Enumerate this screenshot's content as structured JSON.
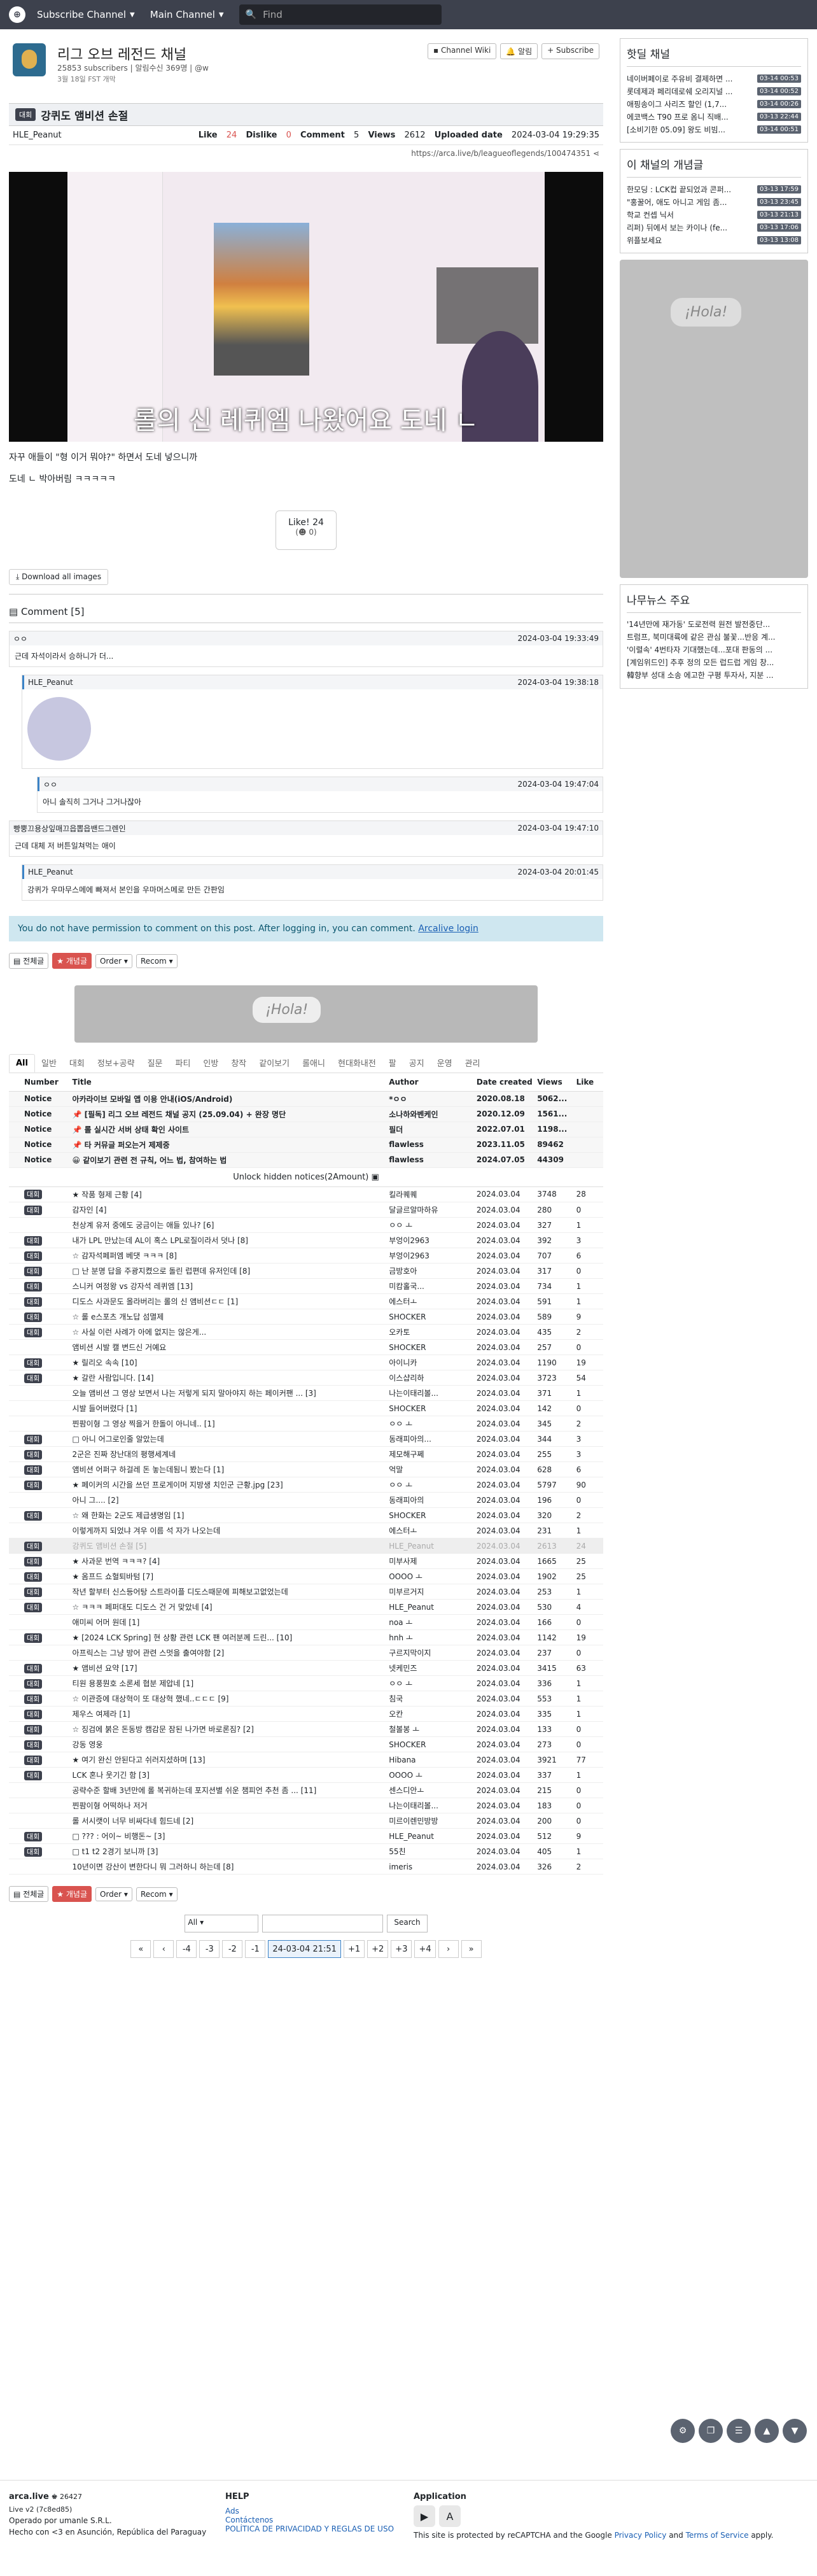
{
  "nav": {
    "channel_menu": "Subscribe Channel",
    "main_menu": "Main Channel",
    "search_placeholder": "Find"
  },
  "channel": {
    "name": "리그 오브 레전드 채널",
    "meta": "25853 subscribers | 알림수신 369명 | @w",
    "created": "3월 18일 FST 개막",
    "btn_wiki": "Channel Wiki",
    "btn_alarm": "알림",
    "btn_sub": "Subscribe"
  },
  "post": {
    "badge": "대회",
    "title": "강퀴도 앰비션 손절",
    "author": "HLE_Peanut",
    "like_label": "Like",
    "like": "24",
    "dislike_label": "Dislike",
    "dislike": "0",
    "comment_label": "Comment",
    "comments": "5",
    "views_label": "Views",
    "views": "2612",
    "uploaded_label": "Uploaded date",
    "uploaded": "2024-03-04 19:29:35",
    "url": "https://arca.live/b/leagueoflegends/100474351",
    "subtitle": "롤의 신 레퀴엠 나왔어요 도네 ㄴ",
    "line1": "자꾸 애들이 \"형 이거 뭐야?\" 하면서 도네 넣으니까",
    "line2": "도네 ㄴ 박아버림 ㅋㅋㅋㅋㅋ",
    "like_btn": "Like!",
    "like_btn_count": "24",
    "like_btn_sub": "0",
    "download": "Download all images"
  },
  "comments": {
    "header": "Comment [5]",
    "items": [
      {
        "author": "ㅇㅇ",
        "time": "2024-03-04 19:33:49",
        "text": "근데 자석이라서 승하니가 더..."
      },
      {
        "author": "HLE_Peanut",
        "time": "2024-03-04 19:38:18",
        "text": ""
      },
      {
        "author": "ㅇㅇ",
        "time": "2024-03-04 19:47:04",
        "text": "아니 솔직히 그거나 그거나잖아"
      },
      {
        "author": "빵뿡끄용상잎매끄읍뽑읍밴드그렌인",
        "time": "2024-03-04 19:47:10",
        "text": "근데 대체 저 버튼일쳐먹는 애이"
      },
      {
        "author": "HLE_Peanut",
        "time": "2024-03-04 20:01:45",
        "text": "강퀴가 우마무스메에 빠져서 본인을 우마머스메로 만든 간판임"
      }
    ],
    "notice": "You do not have permission to comment on this post. After logging in, you can comment.",
    "login": "Arcalive login"
  },
  "toolbar": {
    "all": "전체글",
    "best": "개념글",
    "order": "Order",
    "recom": "Recom"
  },
  "ad_text": "¡Hola!",
  "tabs": [
    "All",
    "일반",
    "대회",
    "정보+공략",
    "질문",
    "파티",
    "인방",
    "창작",
    "같이보기",
    "롤애니",
    "현대화내전",
    "팔",
    "공지",
    "운영",
    "관리"
  ],
  "table": {
    "headers": [
      "Number",
      "Title",
      "Author",
      "Date created",
      "Views",
      "Like"
    ],
    "notices": [
      {
        "n": "Notice",
        "t": "아카라이브 모바일 앱 이용 안내(iOS/Android)",
        "a": "*ㅇㅇ",
        "d": "2020.08.18",
        "v": "5062...",
        "l": ""
      },
      {
        "n": "Notice",
        "t": "📌 [필독] 리그 오브 레전드 채널 공지 (25.09.04) + 완장 명단",
        "a": "소나하와벤케인",
        "d": "2020.12.09",
        "v": "1561...",
        "l": ""
      },
      {
        "n": "Notice",
        "t": "📌 롤 실시간 서버 상태 확인 사이트",
        "a": "필더",
        "d": "2022.07.01",
        "v": "1198...",
        "l": ""
      },
      {
        "n": "Notice",
        "t": "📌 타 커뮤글 퍼오는거 제제중",
        "a": "flawless",
        "d": "2023.11.05",
        "v": "89462",
        "l": ""
      },
      {
        "n": "Notice",
        "t": "😀 같이보기 관련 전 규칙, 어느 법, 참여하는 법",
        "a": "flawless",
        "d": "2024.07.05",
        "v": "44309",
        "l": ""
      }
    ],
    "unlock": "Unlock hidden notices(2Amount)",
    "rows": [
      {
        "c": "대회",
        "t": "★ 작품 형제 근황 [4]",
        "a": "킬라퀘퀘",
        "d": "2024.03.04",
        "v": "3748",
        "l": "28"
      },
      {
        "c": "대회",
        "t": "감자인 [4]",
        "a": "달글르알마하유",
        "d": "2024.03.04",
        "v": "280",
        "l": "0"
      },
      {
        "c": "",
        "t": "천상계 유저 중에도 궁금이는 애들 있나? [6]",
        "a": "ㅇㅇ ㅗ",
        "d": "2024.03.04",
        "v": "327",
        "l": "1"
      },
      {
        "c": "대회",
        "t": "내가 LPL 만났는데 AL이 혹스 LPL로질이라서 덧나 [8]",
        "a": "부엉이2963",
        "d": "2024.03.04",
        "v": "392",
        "l": "3"
      },
      {
        "c": "대회",
        "t": "☆ 감자석페퍼엠 베댓 ㅋㅋㅋ [8]",
        "a": "부엉이2963",
        "d": "2024.03.04",
        "v": "707",
        "l": "6"
      },
      {
        "c": "대회",
        "t": "□ 난 분명 답을 주광지켰으로 돌린 럽편데 유저인데 [8]",
        "a": "금방호아",
        "d": "2024.03.04",
        "v": "317",
        "l": "0"
      },
      {
        "c": "대회",
        "t": "스니커 여정왕 vs 강자석 레퀴엠 [13]",
        "a": "미캄홀국...",
        "d": "2024.03.04",
        "v": "734",
        "l": "1"
      },
      {
        "c": "대회",
        "t": "디도스 사과문도 올라버리는 롤의 신 앰비션ㄷㄷ [1]",
        "a": "에스터ㅗ",
        "d": "2024.03.04",
        "v": "591",
        "l": "1"
      },
      {
        "c": "대회",
        "t": "☆ 롤 e스포츠 개노답 섬멸제",
        "a": "SHOCKER",
        "d": "2024.03.04",
        "v": "589",
        "l": "9"
      },
      {
        "c": "대회",
        "t": "☆ 사실 이런 사례가 아에 없지는 않은게...",
        "a": "오카토",
        "d": "2024.03.04",
        "v": "435",
        "l": "2"
      },
      {
        "c": "",
        "t": "앰비션 시발 캘 변드신 거예요",
        "a": "SHOCKER",
        "d": "2024.03.04",
        "v": "257",
        "l": "0"
      },
      {
        "c": "대회",
        "t": "★ 릴리오 속속 [10]",
        "a": "아이니카",
        "d": "2024.03.04",
        "v": "1190",
        "l": "19"
      },
      {
        "c": "대회",
        "t": "★ 갈란 사람입니다. [14]",
        "a": "이스샵리하",
        "d": "2024.03.04",
        "v": "3723",
        "l": "54"
      },
      {
        "c": "",
        "t": "오늘 앰비션 그 영상 보면서 나는 저렇게 되지 말아야지 하는 페이커팬 ... [3]",
        "a": "나는이태리볼...",
        "d": "2024.03.04",
        "v": "371",
        "l": "1"
      },
      {
        "c": "",
        "t": "시발 들어버렸다 [1]",
        "a": "SHOCKER",
        "d": "2024.03.04",
        "v": "142",
        "l": "0"
      },
      {
        "c": "",
        "t": "찐팜이형 그 영상 찍을거 한돌이 아니네.. [1]",
        "a": "ㅇㅇ ㅗ",
        "d": "2024.03.04",
        "v": "345",
        "l": "2"
      },
      {
        "c": "대회",
        "t": "□ 아니 어그로인줄 알았는데",
        "a": "동래피아의...",
        "d": "2024.03.04",
        "v": "344",
        "l": "3"
      },
      {
        "c": "대회",
        "t": "2군은 진짜 장난대의 평행세계네",
        "a": "제모해구쩨",
        "d": "2024.03.04",
        "v": "255",
        "l": "3"
      },
      {
        "c": "대회",
        "t": "앰비션 어퍼구 하걸레 돈 놓는데됨니 봤는다 [1]",
        "a": "억말",
        "d": "2024.03.04",
        "v": "628",
        "l": "6"
      },
      {
        "c": "대회",
        "t": "★ 페이커의 시간을 쓰던 프로게이머 지방생 치인군 근황.jpg [23]",
        "a": "ㅇㅇ ㅗ",
        "d": "2024.03.04",
        "v": "5797",
        "l": "90"
      },
      {
        "c": "",
        "t": "아니 그.... [2]",
        "a": "동래피아의",
        "d": "2024.03.04",
        "v": "196",
        "l": "0"
      },
      {
        "c": "대회",
        "t": "☆ 왜 한화는 2군도 제급생명임 [1]",
        "a": "SHOCKER",
        "d": "2024.03.04",
        "v": "320",
        "l": "2"
      },
      {
        "c": "",
        "t": "이렇게까지 되었냐 겨우 이름 석 자가 나오는데",
        "a": "에스터ㅗ",
        "d": "2024.03.04",
        "v": "231",
        "l": "1"
      },
      {
        "c": "대회",
        "t": "강퀴도 앰비션 손절 [5]",
        "a": "HLE_Peanut",
        "d": "2024.03.04",
        "v": "2613",
        "l": "24",
        "hl": true
      },
      {
        "c": "대회",
        "t": "★ 사과문 번역 ㅋㅋㅋ? [4]",
        "a": "미부사제",
        "d": "2024.03.04",
        "v": "1665",
        "l": "25"
      },
      {
        "c": "대회",
        "t": "★ 옴프드 쇼혈퇴바텀 [7]",
        "a": "OOOO ㅗ",
        "d": "2024.03.04",
        "v": "1902",
        "l": "25"
      },
      {
        "c": "대회",
        "t": "작년 할부터 신스등어탕 스트라이플 디도스때문에 피해보고없었는데",
        "a": "미부르거지",
        "d": "2024.03.04",
        "v": "253",
        "l": "1"
      },
      {
        "c": "대회",
        "t": "☆ ㅋㅋㅋ 페퍼대도 디도스 건 거 맞았네 [4]",
        "a": "HLE_Peanut",
        "d": "2024.03.04",
        "v": "530",
        "l": "4"
      },
      {
        "c": "",
        "t": "애미씨 어머 원데 [1]",
        "a": "noa ㅗ",
        "d": "2024.03.04",
        "v": "166",
        "l": "0"
      },
      {
        "c": "대회",
        "t": "★ [2024 LCK Spring] 현 상황 관련 LCK 팬 여러분께 드린... [10]",
        "a": "hnh ㅗ",
        "d": "2024.03.04",
        "v": "1142",
        "l": "19"
      },
      {
        "c": "",
        "t": "아프릭스는 그냥 방어 관련 스멋을 출여야함 [2]",
        "a": "구르지막이지",
        "d": "2024.03.04",
        "v": "237",
        "l": "0"
      },
      {
        "c": "대회",
        "t": "★ 앰비션 요약 [17]",
        "a": "넷케민즈",
        "d": "2024.03.04",
        "v": "3415",
        "l": "63"
      },
      {
        "c": "대회",
        "t": "티원 용풍뭔호 소론세 협분 제압네 [1]",
        "a": "ㅇㅇ ㅗ",
        "d": "2024.03.04",
        "v": "336",
        "l": "1"
      },
      {
        "c": "대회",
        "t": "☆ 이관증에 대상혁이 또 대상혁 했네..ㄷㄷㄷ [9]",
        "a": "침국",
        "d": "2024.03.04",
        "v": "553",
        "l": "1"
      },
      {
        "c": "대회",
        "t": "제우스 여제라 [1]",
        "a": "오칸",
        "d": "2024.03.04",
        "v": "335",
        "l": "1"
      },
      {
        "c": "대회",
        "t": "☆ 징검에 붉은 돈동방 캠감문 잠된 나가면 바로론짐? [2]",
        "a": "철볼봉 ㅗ",
        "d": "2024.03.04",
        "v": "133",
        "l": "0"
      },
      {
        "c": "대회",
        "t": "강동 영웅",
        "a": "SHOCKER",
        "d": "2024.03.04",
        "v": "273",
        "l": "0"
      },
      {
        "c": "대회",
        "t": "★ 여기 완신 안된다고 쉬러지셨하며 [13]",
        "a": "Hibana",
        "d": "2024.03.04",
        "v": "3921",
        "l": "77"
      },
      {
        "c": "대회",
        "t": "LCK 혼나 웃기긴 함 [3]",
        "a": "OOOO ㅗ",
        "d": "2024.03.04",
        "v": "337",
        "l": "1"
      },
      {
        "c": "",
        "t": "공략수준 할배 3년만에 롤 복귀하는데 포지션별 쉬운 챔피언 추천 좀 ... [11]",
        "a": "센스디안ㅗ",
        "d": "2024.03.04",
        "v": "215",
        "l": "0"
      },
      {
        "c": "",
        "t": "찐팜이형 어떡하나 저거",
        "a": "나는이태리볼...",
        "d": "2024.03.04",
        "v": "183",
        "l": "0"
      },
      {
        "c": "",
        "t": "롤 서시랫이 너무 비싸다네 힘드네 [2]",
        "a": "미르이렌민방방",
        "d": "2024.03.04",
        "v": "200",
        "l": "0"
      },
      {
        "c": "대회",
        "t": "□ ??? : 어이~ 비행돈~ [3]",
        "a": "HLE_Peanut",
        "d": "2024.03.04",
        "v": "512",
        "l": "9"
      },
      {
        "c": "대회",
        "t": "□ t1 t2 2경기 보니까 [3]",
        "a": "55친",
        "d": "2024.03.04",
        "v": "405",
        "l": "1"
      },
      {
        "c": "",
        "t": "10년이면 강산이 변한다니 뭐 그러하니 하는데 [8]",
        "a": "imeris",
        "d": "2024.03.04",
        "v": "326",
        "l": "2"
      }
    ]
  },
  "pagination": {
    "first": "«",
    "prev": "‹",
    "pages": [
      "-4",
      "-3",
      "-2",
      "-1"
    ],
    "current": "24-03-04 21:51",
    "next_pages": [
      "+1",
      "+2",
      "+3",
      "+4"
    ],
    "next": "›",
    "last": "»"
  },
  "search": {
    "scope": "All",
    "button": "Search"
  },
  "sidebar": {
    "hot_title": "핫딜 채널",
    "hot": [
      {
        "t": "네이버페이로 주유비 결제하면 ...",
        "ts": "03-14 00:53"
      },
      {
        "t": "롯데제과 페리데로쉐 오리지널 ...",
        "ts": "03-14 00:52"
      },
      {
        "t": "애핑송이그 사리즈 할인 (1,7...",
        "ts": "03-14 00:26"
      },
      {
        "t": "에코백스 T90 프로 옴니 직배...",
        "ts": "03-13 22:44"
      },
      {
        "t": "[소비기한 05.09] 왕도 비빔...",
        "ts": "03-14 00:51"
      }
    ],
    "best_title": "이 채널의 개념글",
    "best": [
      {
        "t": "한모딩 : LCK컵 끝되었과 콘퍼...",
        "ts": "03-13 17:59"
      },
      {
        "t": "\"홍꿀어, 애도 아니고 게임 좀...",
        "ts": "03-13 23:45"
      },
      {
        "t": "학교 컨셉 닉서",
        "ts": "03-13 21:13"
      },
      {
        "t": "리퍼) 뒤에서 보는 카이나 (fe...",
        "ts": "03-13 17:06"
      },
      {
        "t": "위플보세요",
        "ts": "03-13 13:08"
      }
    ],
    "ad_text": "¡Hola!",
    "news_title": "나무뉴스 주요",
    "news": [
      "'14년만에 재가동' 도로전력 원전 발전중단...",
      "트럼프, 북미대륙에 같은 관심 불꽃...반응 계...",
      "'이렬속' 4번타자 기대했는데...포대 판동의 ...",
      "[계임위드인] 추후 정의 모든 럽드럽 게임 창...",
      "韓향부 성대 소송 에고한 구평 투자사, 지분 ..."
    ]
  },
  "footer": {
    "brand": "arca.live",
    "rank": "♚ 26427",
    "version": "Live v2 (7c8ed85)",
    "operated": "Operado por umanle S.R.L.",
    "made": "Hecho con <3 en Asunción, República del Paraguay",
    "help_title": "HELP",
    "help": [
      "Ads",
      "Contáctenos",
      "POLÍTICA DE PRIVACIDAD Y REGLAS DE USO"
    ],
    "app_title": "Application",
    "recaptcha_pre": "This site is protected by reCAPTCHA and the Google",
    "privacy": "Privacy Policy",
    "and": "and",
    "terms": "Terms of Service",
    "apply": "apply."
  }
}
